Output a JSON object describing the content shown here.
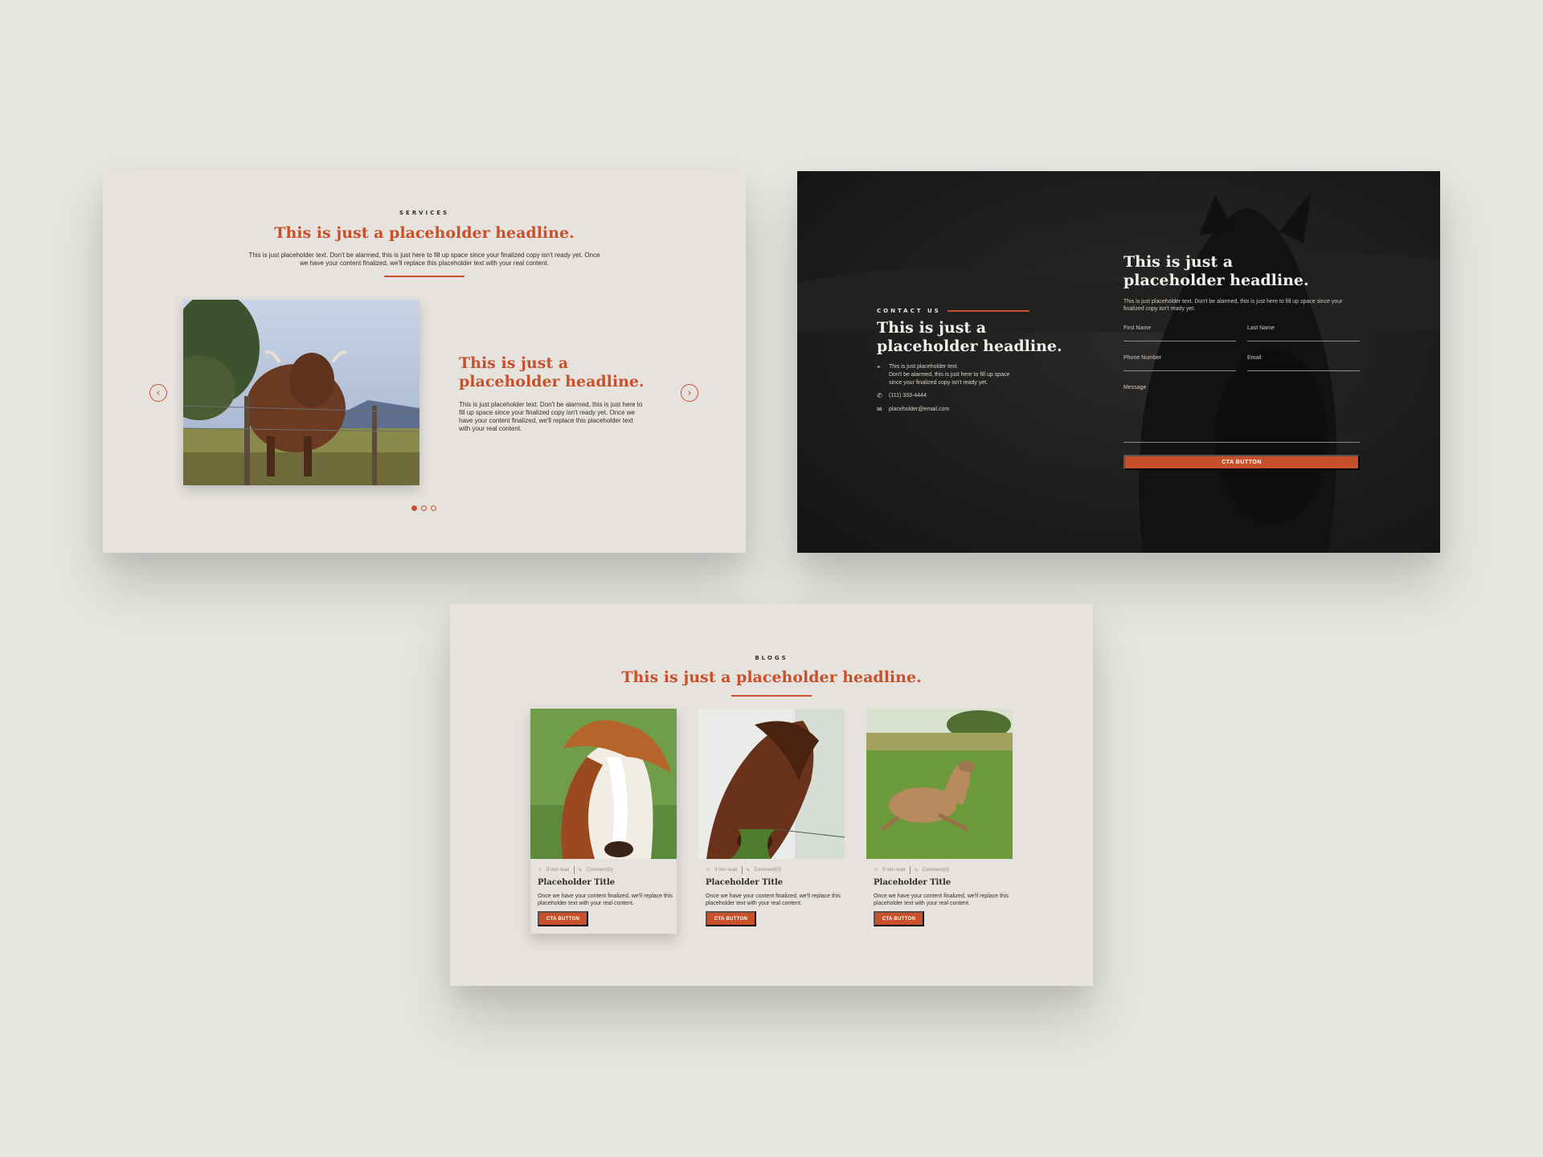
{
  "colors": {
    "accent": "#c8502a",
    "panel_bg": "#e6e3df",
    "page_bg": "#e6e5e2",
    "dark": "#1f1d1c"
  },
  "services": {
    "eyebrow": "SERVICES",
    "headline": "This is just a placeholder headline.",
    "body": "This is just placeholder text. Don't be alarmed, this is just here to fill up space since your finalized copy isn't ready yet. Once we have your content finalized, we'll replace this placeholder text with your real content.",
    "slide_title": "This is just a placeholder headline.",
    "slide_text": "This is just placeholder text. Don't be alarmed, this is just here to fill up space since your finalized copy isn't ready yet. Once we have your content finalized, we'll replace this placeholder text with your real content.",
    "prev_icon": "chevron-left-icon",
    "next_icon": "chevron-right-icon",
    "slides_count": 3,
    "active_slide": 1
  },
  "contact": {
    "eyebrow": "CONTACT US",
    "headline": "This is just a placeholder headline.",
    "address_line1": "This is just placeholder text.",
    "address_line2": "Don't be alarmed, this is just here to fill up space since your finalized copy isn't ready yet.",
    "phone": "(111) 333-4444",
    "email": "placeholder@email.com",
    "form_headline": "This is just a placeholder headline.",
    "form_text": "This is just placeholder text. Don't be alarmed, this is just here to fill up space since your finalized copy isn't ready yet.",
    "fields": {
      "first_name": "First Name",
      "last_name": "Last Name",
      "phone": "Phone Number",
      "email": "Email",
      "message": "Message"
    },
    "cta": "CTA BUTTON"
  },
  "blogs": {
    "eyebrow": "BLOGS",
    "headline": "This is just a placeholder headline.",
    "cards": [
      {
        "read_time": "9 min read",
        "comments": "Comment(0)",
        "title": "Placeholder Title",
        "text": "Once we have your content finalized, we'll replace this placeholder text with your real content.",
        "cta": "CTA BUTTON"
      },
      {
        "read_time": "9 min read",
        "comments": "Comment(0)",
        "title": "Placeholder Title",
        "text": "Once we have your content finalized, we'll replace this placeholder text with your real content.",
        "cta": "CTA BUTTON"
      },
      {
        "read_time": "9 min read",
        "comments": "Comment(0)",
        "title": "Placeholder Title",
        "text": "Once we have your content finalized, we'll replace this placeholder text with your real content.",
        "cta": "CTA BUTTON"
      }
    ]
  }
}
